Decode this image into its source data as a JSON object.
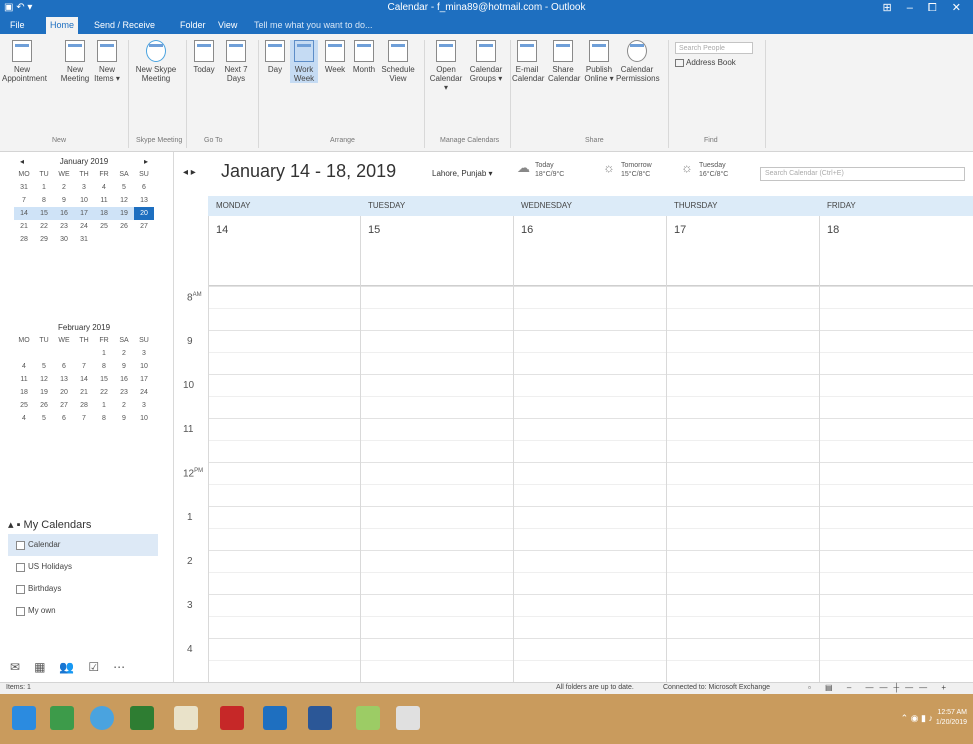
{
  "window": {
    "title": "Calendar - f_mina89@hotmail.com - Outlook",
    "controls": "⊞ – ⧠ ✕"
  },
  "ribbon_tabs": [
    {
      "label": "File"
    },
    {
      "label": "Home"
    },
    {
      "label": "Send / Receive"
    },
    {
      "label": "Folder"
    },
    {
      "label": "View"
    },
    {
      "label": "Tell me what you want to do..."
    }
  ],
  "ribbon": {
    "new_appointment": "New\nAppointment",
    "new_meeting": "New\nMeeting",
    "new_items": "New\nItems ▾",
    "new_skype_meeting": "New Skype\nMeeting",
    "today": "Today",
    "next7": "Next 7\nDays",
    "day": "Day",
    "work_week": "Work\nWeek",
    "week": "Week",
    "month": "Month",
    "schedule_view": "Schedule\nView",
    "open_calendar": "Open\nCalendar ▾",
    "calendar_groups": "Calendar\nGroups ▾",
    "email_calendar": "E-mail\nCalendar",
    "share_calendar": "Share\nCalendar",
    "publish_online": "Publish\nOnline ▾",
    "calendar_permissions": "Calendar\nPermissions",
    "search_people": "Search People",
    "address_book": "Address Book",
    "groups": {
      "new": "New",
      "skype": "Skype Meeting",
      "goto": "Go To",
      "arrange": "Arrange",
      "manage": "Manage Calendars",
      "share": "Share",
      "find": "Find"
    }
  },
  "calendar": {
    "date_range": "January 14 - 18, 2019",
    "location": "Lahore, Punjab ▾",
    "weather": [
      {
        "label": "Today",
        "temp": "18°C/9°C",
        "icon": "cloud-icon"
      },
      {
        "label": "Tomorrow",
        "temp": "15°C/8°C",
        "icon": "sun-icon"
      },
      {
        "label": "Tuesday",
        "temp": "16°C/8°C",
        "icon": "sun-icon"
      }
    ],
    "search_placeholder": "Search Calendar (Ctrl+E)",
    "days": [
      {
        "name": "MONDAY",
        "date": "14"
      },
      {
        "name": "TUESDAY",
        "date": "15"
      },
      {
        "name": "WEDNESDAY",
        "date": "16"
      },
      {
        "name": "THURSDAY",
        "date": "17"
      },
      {
        "name": "FRIDAY",
        "date": "18"
      }
    ],
    "hours": [
      "8",
      "9",
      "10",
      "11",
      "12",
      "1",
      "2",
      "3",
      "4"
    ],
    "hour_suffix_am": "AM",
    "hour_suffix_pm": "PM"
  },
  "minical_jan": {
    "title": "January 2019",
    "weekdays": [
      "MO",
      "TU",
      "WE",
      "TH",
      "FR",
      "SA",
      "SU"
    ],
    "weeks": [
      [
        "31",
        "1",
        "2",
        "3",
        "4",
        "5",
        "6"
      ],
      [
        "7",
        "8",
        "9",
        "10",
        "11",
        "12",
        "13"
      ],
      [
        "14",
        "15",
        "16",
        "17",
        "18",
        "19",
        "20"
      ],
      [
        "21",
        "22",
        "23",
        "24",
        "25",
        "26",
        "27"
      ],
      [
        "28",
        "29",
        "30",
        "31",
        "",
        "",
        ""
      ]
    ],
    "selected_week": 2,
    "today": "20"
  },
  "minical_feb": {
    "title": "February 2019",
    "weekdays": [
      "MO",
      "TU",
      "WE",
      "TH",
      "FR",
      "SA",
      "SU"
    ],
    "weeks": [
      [
        "",
        "",
        "",
        "",
        "1",
        "2",
        "3"
      ],
      [
        "4",
        "5",
        "6",
        "7",
        "8",
        "9",
        "10"
      ],
      [
        "11",
        "12",
        "13",
        "14",
        "15",
        "16",
        "17"
      ],
      [
        "18",
        "19",
        "20",
        "21",
        "22",
        "23",
        "24"
      ],
      [
        "25",
        "26",
        "27",
        "28",
        "1",
        "2",
        "3"
      ],
      [
        "4",
        "5",
        "6",
        "7",
        "8",
        "9",
        "10"
      ]
    ]
  },
  "my_calendars": {
    "header": "My Calendars",
    "items": [
      {
        "label": "Calendar"
      },
      {
        "label": "US Holidays"
      },
      {
        "label": "Birthdays"
      },
      {
        "label": "My own"
      }
    ]
  },
  "status": {
    "items": "Items: 1",
    "folders": "All folders are up to date.",
    "connection": "Connected to: Microsoft Exchange"
  },
  "clock": {
    "time": "12:57 AM",
    "date": "1/20/2019"
  }
}
